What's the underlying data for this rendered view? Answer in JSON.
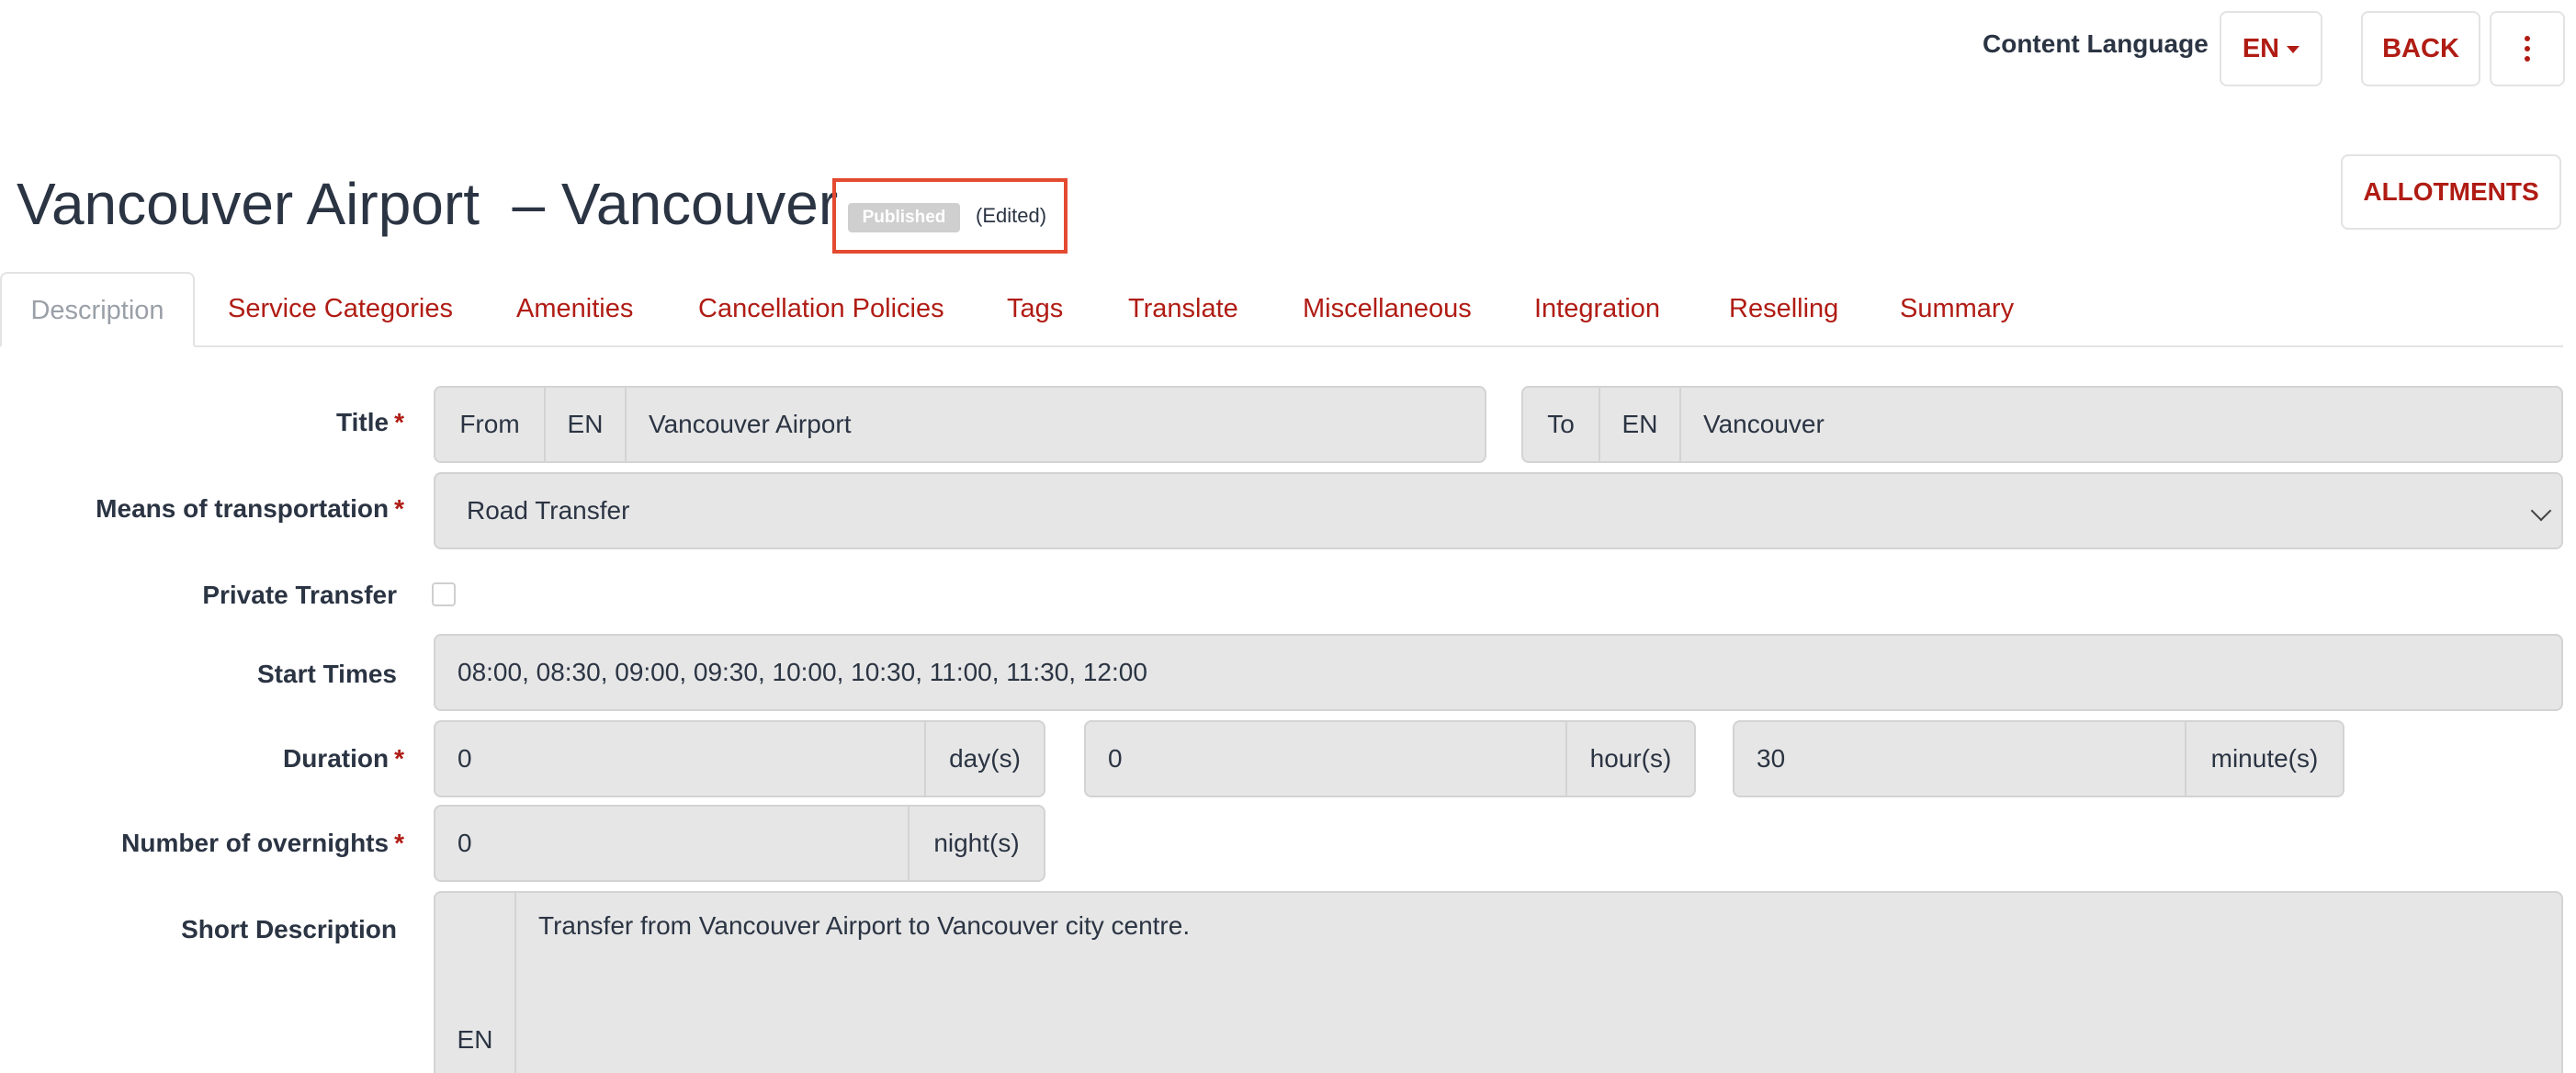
{
  "header": {
    "content_language_label": "Content Language",
    "language_value": "EN",
    "back_label": "BACK",
    "allotments_label": "ALLOTMENTS"
  },
  "page": {
    "title": "Vancouver Airport  – Vancouver",
    "status_badge": "Published",
    "edited_label": "(Edited)"
  },
  "tabs": [
    {
      "label": "Description",
      "active": true
    },
    {
      "label": "Service Categories"
    },
    {
      "label": "Amenities"
    },
    {
      "label": "Cancellation Policies"
    },
    {
      "label": "Tags"
    },
    {
      "label": "Translate"
    },
    {
      "label": "Miscellaneous"
    },
    {
      "label": "Integration"
    },
    {
      "label": "Reselling"
    },
    {
      "label": "Summary"
    }
  ],
  "form": {
    "title": {
      "label": "Title",
      "required_mark": "*",
      "from_label": "From",
      "from_lang": "EN",
      "from_value": "Vancouver Airport",
      "to_label": "To",
      "to_lang": "EN",
      "to_value": "Vancouver"
    },
    "means": {
      "label": "Means of transportation",
      "required_mark": "*",
      "value": "Road Transfer"
    },
    "private": {
      "label": "Private Transfer",
      "checked": false
    },
    "start_times": {
      "label": "Start Times",
      "value": "08:00, 08:30, 09:00, 09:30, 10:00, 10:30, 11:00, 11:30, 12:00"
    },
    "duration": {
      "label": "Duration",
      "required_mark": "*",
      "days": "0",
      "days_unit": "day(s)",
      "hours": "0",
      "hours_unit": "hour(s)",
      "minutes": "30",
      "minutes_unit": "minute(s)"
    },
    "overnights": {
      "label": "Number of overnights",
      "required_mark": "*",
      "value": "0",
      "unit": "night(s)"
    },
    "short_description": {
      "label": "Short Description",
      "lang": "EN",
      "value": "Transfer from Vancouver Airport to Vancouver city centre."
    }
  },
  "colors": {
    "accent": "#b01c14",
    "highlight_box": "#e34a2f",
    "field_bg": "#e6e6e6"
  },
  "icons": {
    "language_dropdown": "caret-down-icon",
    "more_menu": "vertical-dots-icon",
    "select_chevron": "chevron-down-icon"
  }
}
